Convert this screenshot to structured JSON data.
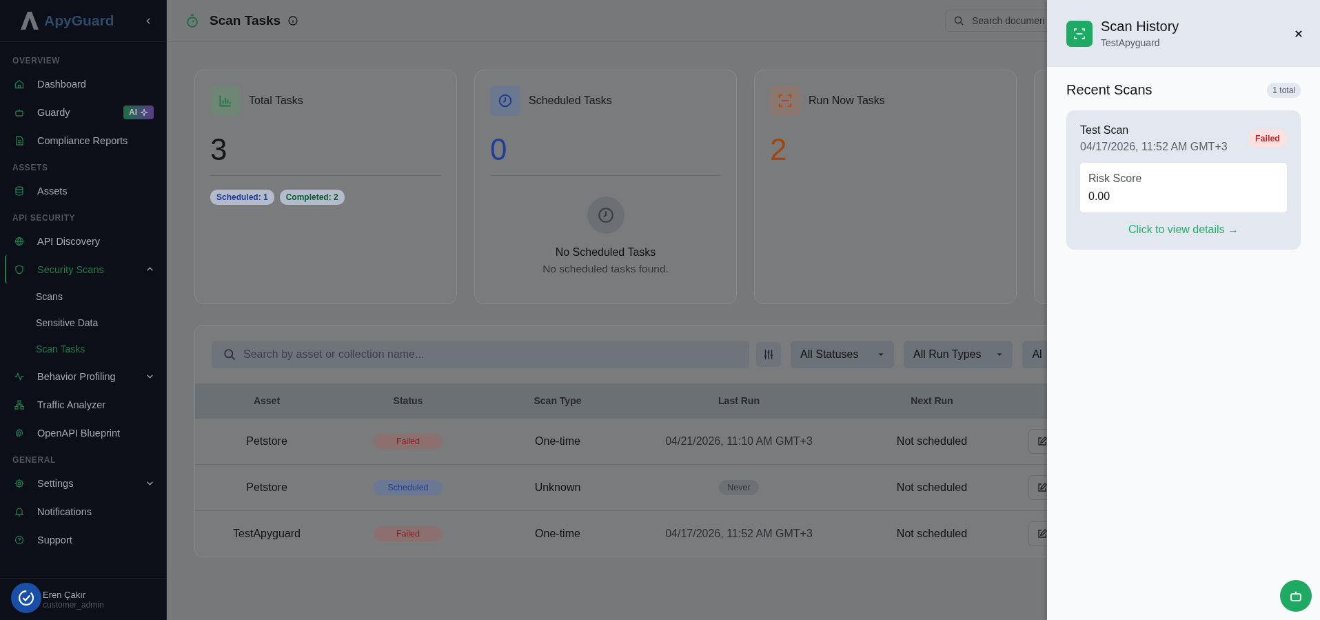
{
  "sidebar": {
    "logo": "ApyGuard",
    "sections": [
      {
        "heading": "OVERVIEW",
        "items": [
          {
            "label": "Dashboard",
            "selected": false
          },
          {
            "label": "Guardy",
            "badge": "AI",
            "selected": false
          },
          {
            "label": "Compliance Reports",
            "selected": false
          }
        ]
      },
      {
        "heading": "ASSETS",
        "items": [
          {
            "label": "Assets",
            "selected": false
          }
        ]
      },
      {
        "heading": "API SECURITY",
        "items": [
          {
            "label": "API Discovery",
            "selected": false
          },
          {
            "label": "Security Scans",
            "selected": true,
            "expanded": true,
            "children": [
              {
                "label": "Scans",
                "selected": false
              },
              {
                "label": "Sensitive Data",
                "selected": false
              },
              {
                "label": "Scan Tasks",
                "selected": true
              }
            ]
          },
          {
            "label": "Behavior Profiling",
            "selected": false,
            "expanded": false
          },
          {
            "label": "Traffic Analyzer",
            "selected": false
          },
          {
            "label": "OpenAPI Blueprint",
            "selected": false
          }
        ]
      },
      {
        "heading": "GENERAL",
        "items": [
          {
            "label": "Settings",
            "selected": false,
            "expanded": false
          },
          {
            "label": "Notifications",
            "selected": false
          },
          {
            "label": "Support",
            "selected": false
          }
        ]
      }
    ],
    "user": {
      "name": "Eren Çakır",
      "role": "customer_admin"
    }
  },
  "header": {
    "title": "Scan Tasks",
    "search": {
      "placeholder": "Search documen"
    }
  },
  "stat_cards": [
    {
      "kind": "total",
      "title": "Total Tasks",
      "value": "3",
      "tags": [
        {
          "label": "Scheduled: 1",
          "color": "#1f3a8f"
        },
        {
          "label": "Completed: 2",
          "color": "#0d5a31"
        }
      ]
    },
    {
      "kind": "scheduled",
      "title": "Scheduled Tasks",
      "value": "0",
      "empty": {
        "title": "No Scheduled Tasks",
        "text": "No scheduled tasks found."
      }
    },
    {
      "kind": "run_now",
      "title": "Run Now Tasks",
      "value": "2"
    }
  ],
  "filters": {
    "search": {
      "placeholder": "Search by asset or collection name..."
    },
    "dropdowns": [
      "All Statuses",
      "All Run Types",
      "Al"
    ]
  },
  "table": {
    "columns": [
      "Asset",
      "Status",
      "Scan Type",
      "Last Run",
      "Next Run"
    ],
    "rows": [
      {
        "asset": "Petstore",
        "status": {
          "label": "Failed",
          "kind": "failed"
        },
        "scan_type": "One-time",
        "last_run": {
          "label": "04/21/2026, 11:10 AM GMT+3",
          "kind": "date"
        },
        "next_run": "Not scheduled"
      },
      {
        "asset": "Petstore",
        "status": {
          "label": "Scheduled",
          "kind": "scheduled"
        },
        "scan_type": "Unknown",
        "last_run": {
          "label": "Never",
          "kind": "badge"
        },
        "next_run": "Not scheduled"
      },
      {
        "asset": "TestApyguard",
        "status": {
          "label": "Failed",
          "kind": "failed"
        },
        "scan_type": "One-time",
        "last_run": {
          "label": "04/17/2026, 11:52 AM GMT+3",
          "kind": "date"
        },
        "next_run": "Not scheduled"
      }
    ]
  },
  "panel": {
    "title": "Scan History",
    "subtitle": "TestApyguard",
    "section": "Recent Scans",
    "count": "1 total",
    "scans": [
      {
        "name": "Test Scan",
        "date": "04/17/2026, 11:52 AM GMT+3",
        "status": {
          "label": "Failed",
          "kind": "failed"
        },
        "risk_label": "Risk Score",
        "risk_value": "0.00",
        "link": "Click to view details →"
      }
    ]
  }
}
